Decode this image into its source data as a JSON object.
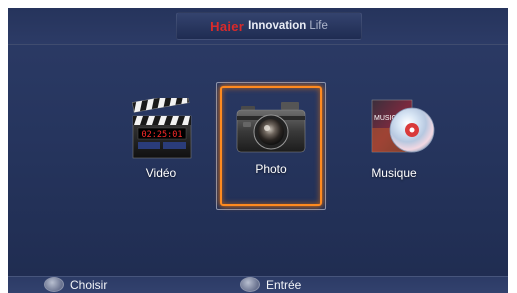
{
  "header": {
    "logo": "Haier",
    "brand_bold": "Innovation",
    "brand_light": "Life"
  },
  "menu": {
    "items": [
      {
        "label": "Vidéo",
        "icon": "clapperboard-icon"
      },
      {
        "label": "Photo",
        "icon": "camera-icon",
        "selected": true
      },
      {
        "label": "Musique",
        "icon": "music-cd-icon"
      }
    ],
    "clapper_time": "02:25:01",
    "music_cover_text": "MUSIC"
  },
  "footer": {
    "choose_label": "Choisir",
    "enter_label": "Entrée"
  },
  "colors": {
    "background": "#26355e",
    "selection": "#ff8a1f",
    "brand_red": "#d92a2a"
  }
}
